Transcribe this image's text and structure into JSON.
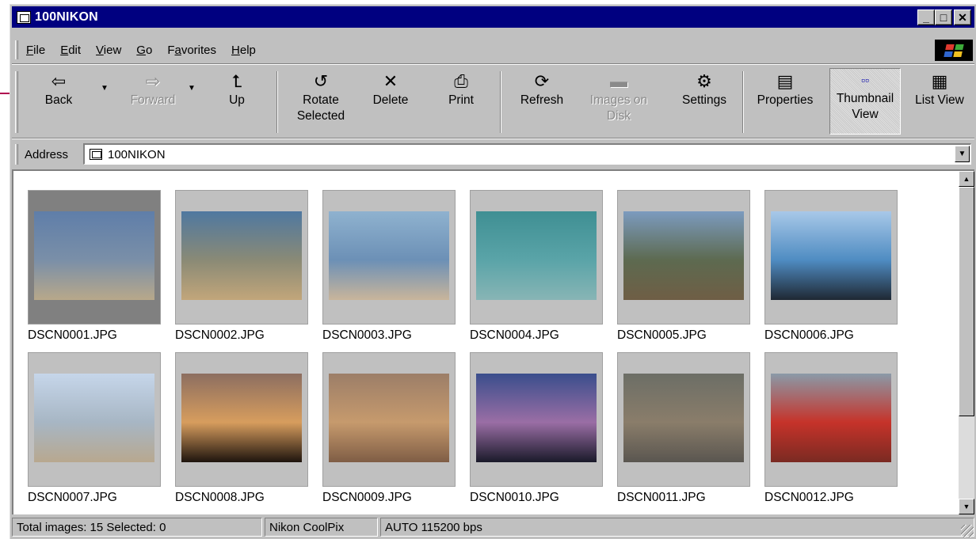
{
  "window": {
    "title": "100NIKON",
    "buttons": {
      "minimize": "_",
      "maximize": "□",
      "close": "✕"
    }
  },
  "menu": [
    "File",
    "Edit",
    "View",
    "Go",
    "Favorites",
    "Help"
  ],
  "menu_underline": [
    "F",
    "E",
    "V",
    "G",
    "a",
    "H"
  ],
  "toolbar": {
    "back": {
      "label": "Back",
      "icon": "back-arrow-icon",
      "glyph": "⇦"
    },
    "forward": {
      "label": "Forward",
      "icon": "forward-arrow-icon",
      "glyph": "⇨"
    },
    "up": {
      "label": "Up",
      "icon": "up-folder-icon",
      "glyph": "⮤"
    },
    "rotate": {
      "label1": "Rotate",
      "label2": "Selected",
      "icon": "rotate-icon",
      "glyph": "↺"
    },
    "delete": {
      "label": "Delete",
      "icon": "delete-x-icon",
      "glyph": "✕"
    },
    "print": {
      "label": "Print",
      "icon": "printer-icon",
      "glyph": "⎙"
    },
    "refresh": {
      "label": "Refresh",
      "icon": "refresh-icon",
      "glyph": "⟳"
    },
    "images_on_disk": {
      "label1": "Images on",
      "label2": "Disk",
      "icon": "disk-icon",
      "glyph": "▬"
    },
    "settings": {
      "label": "Settings",
      "icon": "settings-icon",
      "glyph": "⚙"
    },
    "properties": {
      "label": "Properties",
      "icon": "properties-icon",
      "glyph": "▤"
    },
    "thumbnail_view": {
      "label1": "Thumbnail",
      "label2": "View",
      "icon": "thumbnail-view-icon",
      "glyph": "▫▫"
    },
    "list_view": {
      "label": "List View",
      "icon": "list-view-icon",
      "glyph": "▦"
    }
  },
  "address": {
    "label": "Address",
    "value": "100NIKON"
  },
  "thumbnails": [
    {
      "name": "DSCN0001.JPG",
      "selected": true,
      "colors": [
        "#5f7ea9",
        "#7a8fa8",
        "#b8a88a"
      ]
    },
    {
      "name": "DSCN0002.JPG",
      "selected": false,
      "colors": [
        "#4f78a0",
        "#8a8a76",
        "#c2a67a"
      ]
    },
    {
      "name": "DSCN0003.JPG",
      "selected": false,
      "colors": [
        "#8fb2cf",
        "#6c90b6",
        "#c9b59b"
      ]
    },
    {
      "name": "DSCN0004.JPG",
      "selected": false,
      "colors": [
        "#3f8f93",
        "#5aa4a8",
        "#88b5b5"
      ]
    },
    {
      "name": "DSCN0005.JPG",
      "selected": false,
      "colors": [
        "#7c9bbf",
        "#5d6a50",
        "#6f5e45"
      ]
    },
    {
      "name": "DSCN0006.JPG",
      "selected": false,
      "colors": [
        "#a8c8e8",
        "#4f8cc2",
        "#1f2833"
      ]
    },
    {
      "name": "DSCN0007.JPG",
      "selected": false,
      "colors": [
        "#c6d6ea",
        "#a7b6c4",
        "#b8a88f"
      ]
    },
    {
      "name": "DSCN0008.JPG",
      "selected": false,
      "colors": [
        "#8c6e60",
        "#d79d5e",
        "#1e140e"
      ]
    },
    {
      "name": "DSCN0009.JPG",
      "selected": false,
      "colors": [
        "#9c7e68",
        "#c69a6d",
        "#7f5d45"
      ]
    },
    {
      "name": "DSCN0010.JPG",
      "selected": false,
      "colors": [
        "#3a4e8c",
        "#9a6ea5",
        "#1a1a2a"
      ]
    },
    {
      "name": "DSCN0011.JPG",
      "selected": false,
      "colors": [
        "#6c6e66",
        "#8a7d6a",
        "#5a5650"
      ]
    },
    {
      "name": "DSCN0012.JPG",
      "selected": false,
      "colors": [
        "#8a9aa8",
        "#c6332a",
        "#7a2a22"
      ]
    }
  ],
  "status": {
    "counts": "Total images: 15   Selected: 0",
    "camera": "Nikon CoolPix",
    "connection": "AUTO  115200 bps"
  },
  "colors": {
    "titlebar": "#000080",
    "chrome": "#c0c0c0",
    "accent_line": "#b0004e"
  }
}
